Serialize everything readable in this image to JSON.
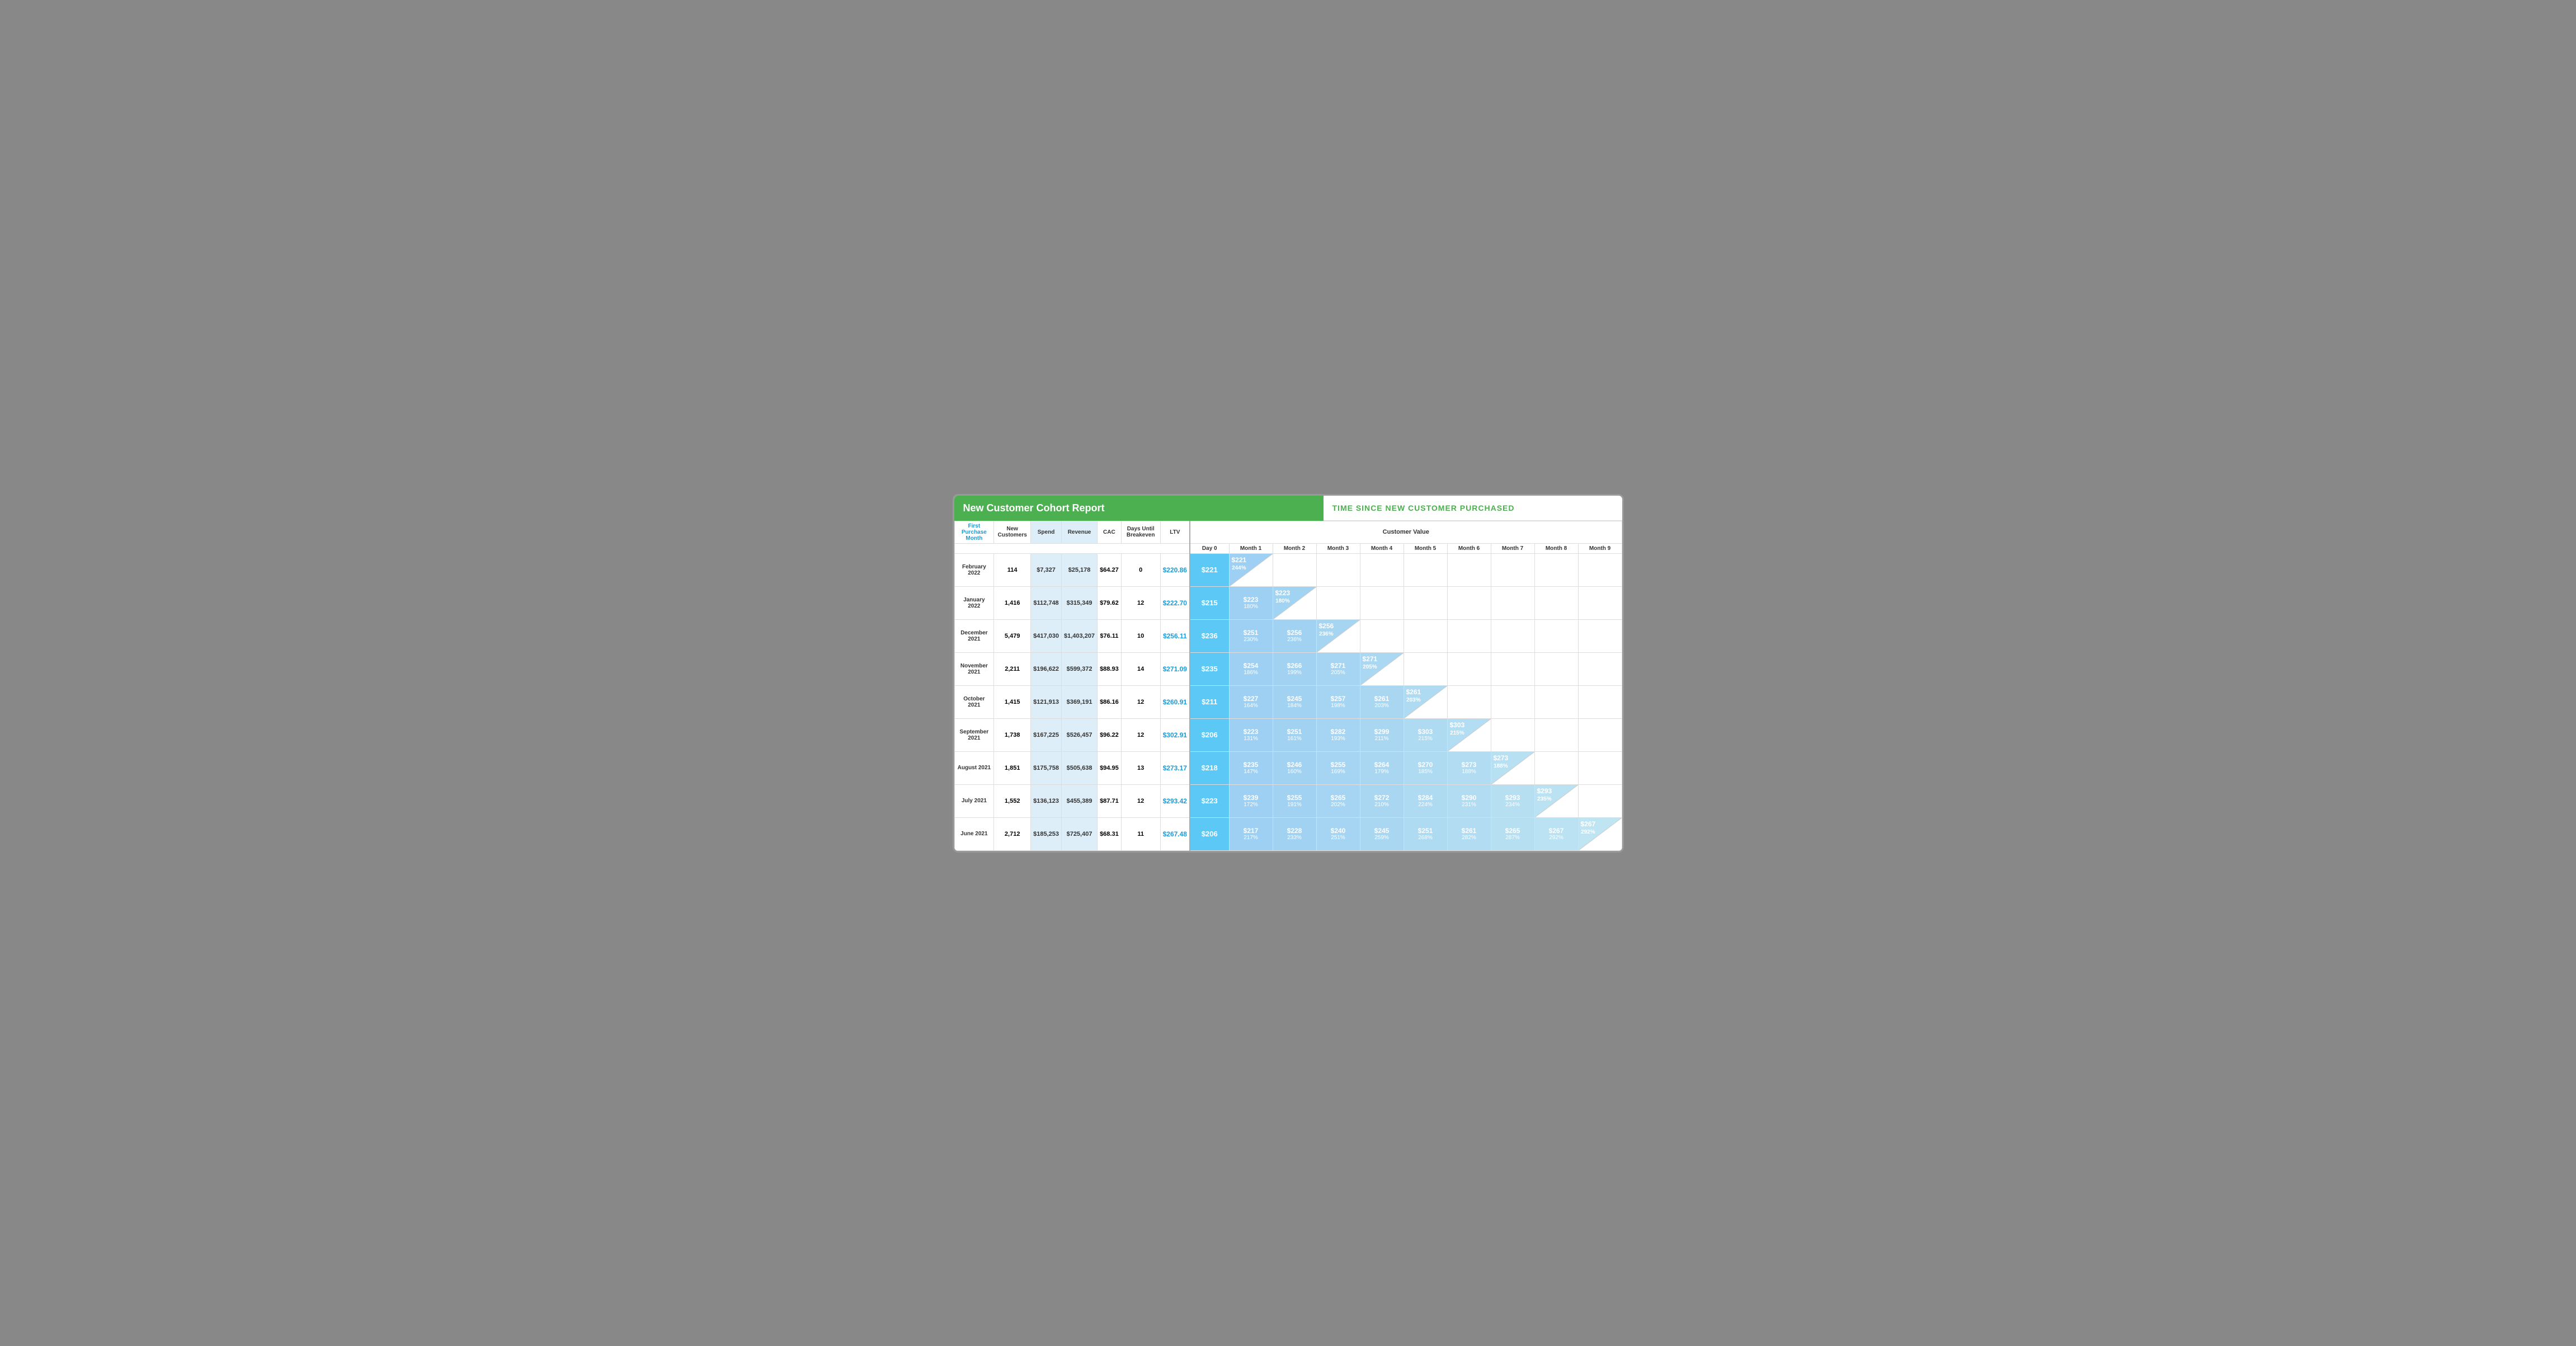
{
  "report": {
    "title": "New Customer Cohort Report",
    "time_header": "TIME SINCE NEW CUSTOMER PURCHASED",
    "customer_value_label": "Customer Value",
    "columns": {
      "first_purchase": "First Purchase Month",
      "new_customers": "New Customers",
      "spend": "Spend",
      "revenue": "Revenue",
      "cac": "CAC",
      "days_until_breakeven": "Days Until Breakeven",
      "ltv": "LTV"
    },
    "cohort_columns": [
      "Day 0",
      "Month 1",
      "Month 2",
      "Month 3",
      "Month 4",
      "Month 5",
      "Month 6",
      "Month 7",
      "Month 8",
      "Month 9"
    ],
    "rows": [
      {
        "month": "February 2022",
        "new_customers": "114",
        "spend": "$7,327",
        "revenue": "$25,178",
        "cac": "$64.27",
        "days_breakeven": "0",
        "ltv": "$220.86",
        "day0": "$221",
        "cohort": [
          {
            "val": "$221",
            "pct": "244%",
            "diag": true
          },
          null,
          null,
          null,
          null,
          null,
          null,
          null,
          null
        ]
      },
      {
        "month": "January 2022",
        "new_customers": "1,416",
        "spend": "$112,748",
        "revenue": "$315,349",
        "cac": "$79.62",
        "days_breakeven": "12",
        "ltv": "$222.70",
        "day0": "$215",
        "cohort": [
          {
            "val": "$223",
            "pct": "180%",
            "diag": false
          },
          {
            "val": "$223",
            "pct": "180%",
            "diag": true
          },
          null,
          null,
          null,
          null,
          null,
          null,
          null
        ]
      },
      {
        "month": "December 2021",
        "new_customers": "5,479",
        "spend": "$417,030",
        "revenue": "$1,403,207",
        "cac": "$76.11",
        "days_breakeven": "10",
        "ltv": "$256.11",
        "day0": "$236",
        "cohort": [
          {
            "val": "$251",
            "pct": "230%",
            "diag": false
          },
          {
            "val": "$256",
            "pct": "236%",
            "diag": false
          },
          {
            "val": "$256",
            "pct": "236%",
            "diag": true
          },
          null,
          null,
          null,
          null,
          null,
          null
        ]
      },
      {
        "month": "November 2021",
        "new_customers": "2,211",
        "spend": "$196,622",
        "revenue": "$599,372",
        "cac": "$88.93",
        "days_breakeven": "14",
        "ltv": "$271.09",
        "day0": "$235",
        "cohort": [
          {
            "val": "$254",
            "pct": "186%",
            "diag": false
          },
          {
            "val": "$266",
            "pct": "199%",
            "diag": false
          },
          {
            "val": "$271",
            "pct": "205%",
            "diag": false
          },
          {
            "val": "$271",
            "pct": "205%",
            "diag": true
          },
          null,
          null,
          null,
          null,
          null
        ]
      },
      {
        "month": "October 2021",
        "new_customers": "1,415",
        "spend": "$121,913",
        "revenue": "$369,191",
        "cac": "$86.16",
        "days_breakeven": "12",
        "ltv": "$260.91",
        "day0": "$211",
        "cohort": [
          {
            "val": "$227",
            "pct": "164%",
            "diag": false
          },
          {
            "val": "$245",
            "pct": "184%",
            "diag": false
          },
          {
            "val": "$257",
            "pct": "198%",
            "diag": false
          },
          {
            "val": "$261",
            "pct": "203%",
            "diag": false
          },
          {
            "val": "$261",
            "pct": "203%",
            "diag": true
          },
          null,
          null,
          null,
          null
        ]
      },
      {
        "month": "September 2021",
        "new_customers": "1,738",
        "spend": "$167,225",
        "revenue": "$526,457",
        "cac": "$96.22",
        "days_breakeven": "12",
        "ltv": "$302.91",
        "day0": "$206",
        "cohort": [
          {
            "val": "$223",
            "pct": "131%",
            "diag": false
          },
          {
            "val": "$251",
            "pct": "161%",
            "diag": false
          },
          {
            "val": "$282",
            "pct": "193%",
            "diag": false
          },
          {
            "val": "$299",
            "pct": "211%",
            "diag": false
          },
          {
            "val": "$303",
            "pct": "215%",
            "diag": false
          },
          {
            "val": "$303",
            "pct": "215%",
            "diag": true
          },
          null,
          null,
          null
        ]
      },
      {
        "month": "August 2021",
        "new_customers": "1,851",
        "spend": "$175,758",
        "revenue": "$505,638",
        "cac": "$94.95",
        "days_breakeven": "13",
        "ltv": "$273.17",
        "day0": "$218",
        "cohort": [
          {
            "val": "$235",
            "pct": "147%",
            "diag": false
          },
          {
            "val": "$246",
            "pct": "160%",
            "diag": false
          },
          {
            "val": "$255",
            "pct": "169%",
            "diag": false
          },
          {
            "val": "$264",
            "pct": "179%",
            "diag": false
          },
          {
            "val": "$270",
            "pct": "185%",
            "diag": false
          },
          {
            "val": "$273",
            "pct": "188%",
            "diag": false
          },
          {
            "val": "$273",
            "pct": "188%",
            "diag": true
          },
          null,
          null
        ]
      },
      {
        "month": "July 2021",
        "new_customers": "1,552",
        "spend": "$136,123",
        "revenue": "$455,389",
        "cac": "$87.71",
        "days_breakeven": "12",
        "ltv": "$293.42",
        "day0": "$223",
        "cohort": [
          {
            "val": "$239",
            "pct": "172%",
            "diag": false
          },
          {
            "val": "$255",
            "pct": "191%",
            "diag": false
          },
          {
            "val": "$265",
            "pct": "202%",
            "diag": false
          },
          {
            "val": "$272",
            "pct": "210%",
            "diag": false
          },
          {
            "val": "$284",
            "pct": "224%",
            "diag": false
          },
          {
            "val": "$290",
            "pct": "231%",
            "diag": false
          },
          {
            "val": "$293",
            "pct": "234%",
            "diag": false
          },
          {
            "val": "$293",
            "pct": "235%",
            "diag": true
          },
          null
        ]
      },
      {
        "month": "June 2021",
        "new_customers": "2,712",
        "spend": "$185,253",
        "revenue": "$725,407",
        "cac": "$68.31",
        "days_breakeven": "11",
        "ltv": "$267.48",
        "day0": "$206",
        "cohort": [
          {
            "val": "$217",
            "pct": "217%",
            "diag": false
          },
          {
            "val": "$228",
            "pct": "233%",
            "diag": false
          },
          {
            "val": "$240",
            "pct": "251%",
            "diag": false
          },
          {
            "val": "$245",
            "pct": "259%",
            "diag": false
          },
          {
            "val": "$251",
            "pct": "268%",
            "diag": false
          },
          {
            "val": "$261",
            "pct": "282%",
            "diag": false
          },
          {
            "val": "$265",
            "pct": "287%",
            "diag": false
          },
          {
            "val": "$267",
            "pct": "292%",
            "diag": false
          },
          {
            "val": "$267",
            "pct": "292%",
            "diag": true
          }
        ]
      }
    ]
  }
}
